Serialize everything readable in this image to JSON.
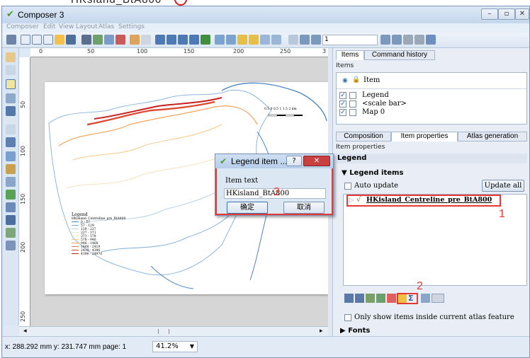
{
  "caption_fragment": "HKsland_BtA800",
  "window": {
    "title": "Composer 3"
  },
  "menubar": [
    "Composer",
    "Edit",
    "View",
    "Layout",
    "Atlas",
    "Settings"
  ],
  "atlas_toolbar": {
    "page_value": "1"
  },
  "hruler_ticks": [
    "0",
    "50",
    "100",
    "150",
    "200",
    "250",
    "3"
  ],
  "vruler_ticks": [
    "50",
    "100",
    "150",
    "200",
    "250"
  ],
  "map": {
    "scalebar_labels": "0.5 0 0.5 1 1.5 2 km",
    "legend_title": "Legend",
    "legend_layer": "HKisland_Centreline_pre_BtA800",
    "legend_classes": [
      {
        "label": "0 - 57",
        "color": "#4c84c4"
      },
      {
        "label": "57 - 129",
        "color": "#7fb0d8"
      },
      {
        "label": "129 - 227",
        "color": "#b7d3e6"
      },
      {
        "label": "227 - 371",
        "color": "#e3e9d5"
      },
      {
        "label": "371 - 578",
        "color": "#f6e2bb"
      },
      {
        "label": "578 - 946",
        "color": "#f8c98a"
      },
      {
        "label": "946 - 1468",
        "color": "#f4a45c"
      },
      {
        "label": "1468 - 2419",
        "color": "#ea7a43"
      },
      {
        "label": "2419 - 4396",
        "color": "#dd4a32"
      },
      {
        "label": "4396 - 24970",
        "color": "#c81e1e"
      }
    ]
  },
  "statusbar": {
    "coords": "x: 288.292 mm y: 231.747 mm page: 1",
    "zoom": "41.2%"
  },
  "panel_top": {
    "tabs": [
      "Items",
      "Command history"
    ],
    "section": "Items",
    "header_item": "Item",
    "items": [
      {
        "label": "Legend",
        "checked": "✓"
      },
      {
        "label": "<scale bar>",
        "checked": "✓"
      },
      {
        "label": "Map 0",
        "checked": "✓"
      }
    ]
  },
  "panel_bottom": {
    "tabs": [
      "Composition",
      "Item properties",
      "Atlas generation"
    ],
    "subtitle": "Item properties",
    "header": "Legend",
    "group_legend_items": "Legend items",
    "auto_update": "Auto update",
    "update_all": "Update all",
    "tree_item": "HKisland_Centreline_pre_BtA800",
    "atlas_checkbox": "Only show items inside current atlas feature",
    "fonts": "Fonts"
  },
  "dialog": {
    "title": "Legend item ...",
    "help": "?",
    "close": "✕",
    "field_label": "Item text",
    "field_value": "HKisland_BtA800",
    "ok": "确定",
    "cancel": "取消"
  },
  "annotations": {
    "one": "1",
    "two": "2",
    "three": "3"
  },
  "colors": {
    "annotation": "#e53935",
    "accent": "#3a6fb0"
  }
}
